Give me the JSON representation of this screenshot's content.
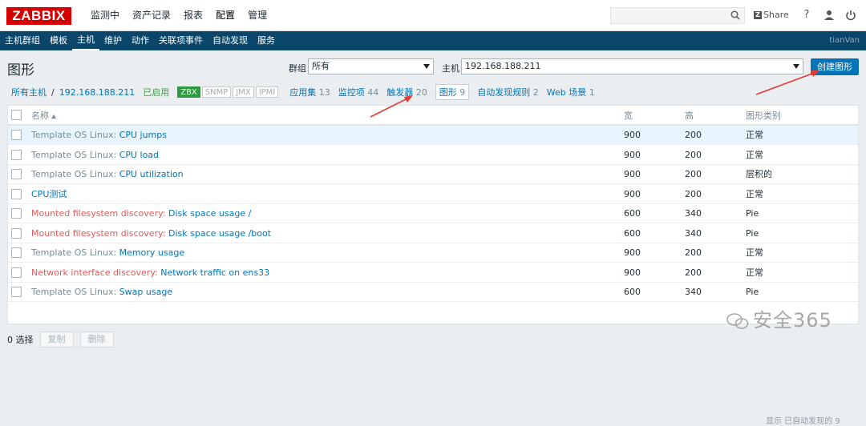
{
  "app": {
    "logo": "ZABBIX",
    "user": "tianVan"
  },
  "topmenu": [
    "监测中",
    "资产记录",
    "报表",
    "配置",
    "管理"
  ],
  "topbar": {
    "share_label": "Share",
    "help_icon": "?"
  },
  "subnav": [
    "主机群组",
    "模板",
    "主机",
    "维护",
    "动作",
    "关联项事件",
    "自动发现",
    "服务"
  ],
  "page": {
    "title": "图形",
    "create_button": "创建图形"
  },
  "filters": {
    "group_label": "群组",
    "group_value": "所有",
    "host_label": "主机",
    "host_value": "192.168.188.211"
  },
  "breadcrumb": {
    "all_hosts": "所有主机",
    "separator": "/",
    "host": "192.168.188.211",
    "status": "已启用"
  },
  "badges": [
    "ZBX",
    "SNMP",
    "JMX",
    "IPMI"
  ],
  "tabs": [
    {
      "label": "应用集",
      "count": "13"
    },
    {
      "label": "监控项",
      "count": "44"
    },
    {
      "label": "触发器",
      "count": "20"
    },
    {
      "label": "图形",
      "count": "9"
    },
    {
      "label": "自动发现规则",
      "count": "2"
    },
    {
      "label": "Web 场景",
      "count": "1"
    }
  ],
  "table": {
    "headers": {
      "name": "名称",
      "width": "宽",
      "height": "高",
      "type": "图形类别"
    },
    "rows": [
      {
        "prefix": "Template OS Linux: ",
        "prefix_color": "gray",
        "name": "CPU jumps",
        "width": "900",
        "height": "200",
        "type": "正常"
      },
      {
        "prefix": "Template OS Linux: ",
        "prefix_color": "gray",
        "name": "CPU load",
        "width": "900",
        "height": "200",
        "type": "正常"
      },
      {
        "prefix": "Template OS Linux: ",
        "prefix_color": "gray",
        "name": "CPU utilization",
        "width": "900",
        "height": "200",
        "type": "层积的"
      },
      {
        "prefix": "",
        "prefix_color": "gray",
        "name": "CPU测试",
        "width": "900",
        "height": "200",
        "type": "正常"
      },
      {
        "prefix": "Mounted filesystem discovery: ",
        "prefix_color": "red",
        "name": "Disk space usage /",
        "width": "600",
        "height": "340",
        "type": "Pie"
      },
      {
        "prefix": "Mounted filesystem discovery: ",
        "prefix_color": "red",
        "name": "Disk space usage /boot",
        "width": "600",
        "height": "340",
        "type": "Pie"
      },
      {
        "prefix": "Template OS Linux: ",
        "prefix_color": "gray",
        "name": "Memory usage",
        "width": "900",
        "height": "200",
        "type": "正常"
      },
      {
        "prefix": "Network interface discovery: ",
        "prefix_color": "red",
        "name": "Network traffic on ens33",
        "width": "900",
        "height": "200",
        "type": "正常"
      },
      {
        "prefix": "Template OS Linux: ",
        "prefix_color": "gray",
        "name": "Swap usage",
        "width": "600",
        "height": "340",
        "type": "Pie"
      }
    ],
    "found_text": "显示 已自动发现的 9"
  },
  "footer": {
    "selected": "0 选择",
    "copy": "复制",
    "delete": "删除"
  },
  "watermark": "安全365",
  "colors": {
    "brand": "#d40000",
    "nav": "#0a466a",
    "link": "#0275b8",
    "enabled": "#429e47",
    "discovered": "#e45959"
  }
}
